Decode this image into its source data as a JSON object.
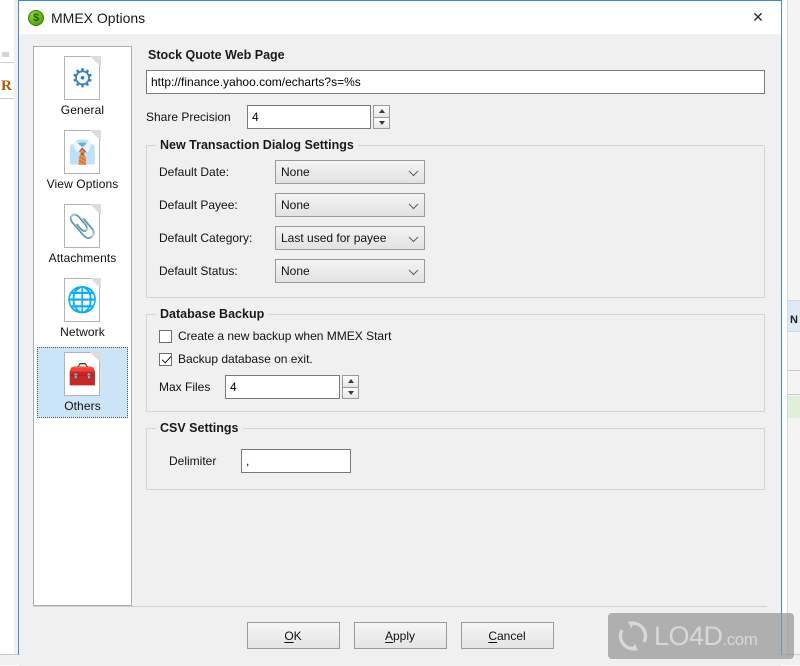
{
  "window": {
    "title": "MMEX Options",
    "icon": "dollar-coin-icon",
    "icon_glyph": "$",
    "close_label": "✕",
    "accent_color": "#3c8cd4"
  },
  "sidebar": {
    "items": [
      {
        "label": "General",
        "icon": "gear-document-icon",
        "glyph": "⚙",
        "color": "#3f83c4",
        "selected": false
      },
      {
        "label": "View Options",
        "icon": "suits-document-icon",
        "glyph": "👔",
        "color": "#2d2d2d",
        "selected": false
      },
      {
        "label": "Attachments",
        "icon": "paperclip-folder-icon",
        "glyph": "📎",
        "color": "#5aa6dd",
        "selected": false
      },
      {
        "label": "Network",
        "icon": "globe-network-icon",
        "glyph": "🌐",
        "color": "#2b6fb0",
        "selected": false
      },
      {
        "label": "Others",
        "icon": "toolbox-document-icon",
        "glyph": "🧰",
        "color": "#c9a06a",
        "selected": true
      }
    ]
  },
  "main": {
    "stock_quote": {
      "title": "Stock Quote Web Page",
      "url_value": "http://finance.yahoo.com/echarts?s=%s",
      "url_placeholder": "http://"
    },
    "share_precision": {
      "label": "Share Precision",
      "value": "4"
    },
    "transaction_group": {
      "legend": "New Transaction Dialog Settings",
      "fields": [
        {
          "label": "Default Date:",
          "value": "None"
        },
        {
          "label": "Default Payee:",
          "value": "None"
        },
        {
          "label": "Default Category:",
          "value": "Last used for payee"
        },
        {
          "label": "Default Status:",
          "value": "None"
        }
      ]
    },
    "backup_group": {
      "legend": "Database Backup",
      "checkboxes": [
        {
          "label": "Create a new backup when MMEX Start",
          "checked": false
        },
        {
          "label": "Backup database on exit.",
          "checked": true
        }
      ],
      "max_files": {
        "label": "Max Files",
        "value": "4"
      }
    },
    "csv_group": {
      "legend": "CSV Settings",
      "delimiter": {
        "label": "Delimiter",
        "value": ","
      }
    }
  },
  "footer": {
    "buttons": [
      {
        "label": "OK",
        "mnemonic": "O",
        "rest": "K"
      },
      {
        "label": "Apply",
        "mnemonic": "A",
        "rest": "pply"
      },
      {
        "label": "Cancel",
        "mnemonic": "C",
        "rest": "ancel"
      }
    ]
  },
  "watermark": {
    "name": "LO4D",
    "suffix": ".com"
  },
  "background": {
    "left_letter": "R",
    "right_letter": "N"
  }
}
